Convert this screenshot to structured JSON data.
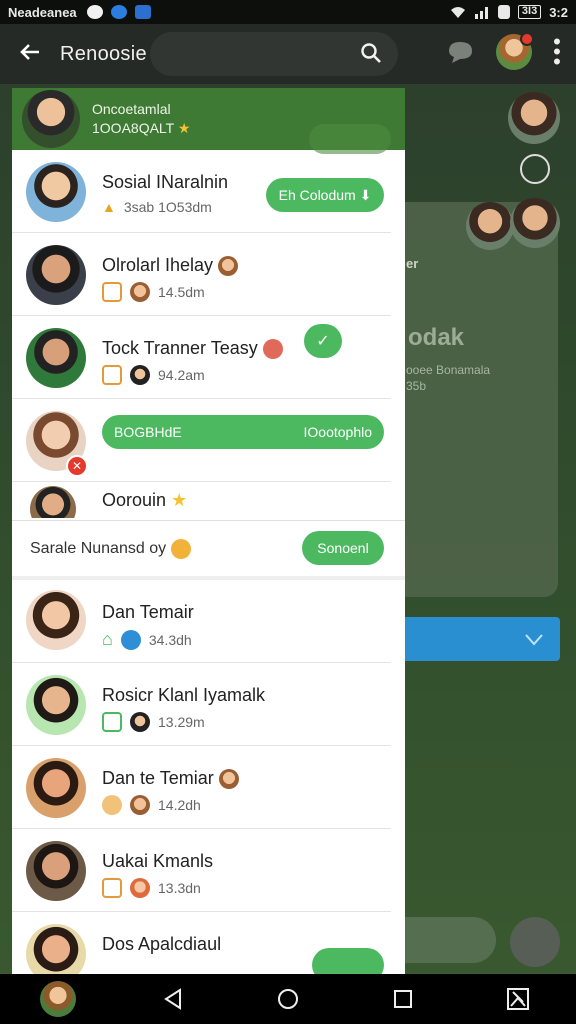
{
  "status_bar": {
    "carrier": "Neadeanea",
    "battery": "3I3",
    "time": "3:2"
  },
  "app_bar": {
    "title": "Renoosie"
  },
  "header": {
    "line1": "Oncoetamlal",
    "line2": "1OOA8QALT"
  },
  "contacts_top": [
    {
      "name": "Sosial INaralnin",
      "meta": "3sab 1O53dm",
      "action": "Eh Colodum"
    },
    {
      "name": "Olrolarl Ihelay",
      "meta": "14.5dm"
    },
    {
      "name": "Tock Tranner Teasy",
      "meta": "94.2am"
    },
    {
      "name": "",
      "meta": "",
      "action_left": "BOGBHdE",
      "action_right": "IOootophlo"
    },
    {
      "name": "Oorouin",
      "meta": ""
    }
  ],
  "suggested": {
    "label": "Sarale Nunansd oy",
    "action": "Sonoenl"
  },
  "contacts_bottom": [
    {
      "name": "Dan Temair",
      "meta": "34.3dh"
    },
    {
      "name": "Rosicr Klanl Iyamalk",
      "meta": "13.29m"
    },
    {
      "name": "Dan te Temiar",
      "meta": "14.2dh"
    },
    {
      "name": "Uakai Kmanls",
      "meta": "13.3dn"
    },
    {
      "name": "Dos Apalcdiaul",
      "meta": ""
    }
  ],
  "background": {
    "title": "odak",
    "subtitle": "ooee Bonamala",
    "subtitle2": "35b",
    "side_label": "er"
  },
  "colors": {
    "accent": "#4cb960",
    "header_green": "#3e7a33",
    "notification": "#e23a2e",
    "blue_bar": "#2a8fd0"
  }
}
